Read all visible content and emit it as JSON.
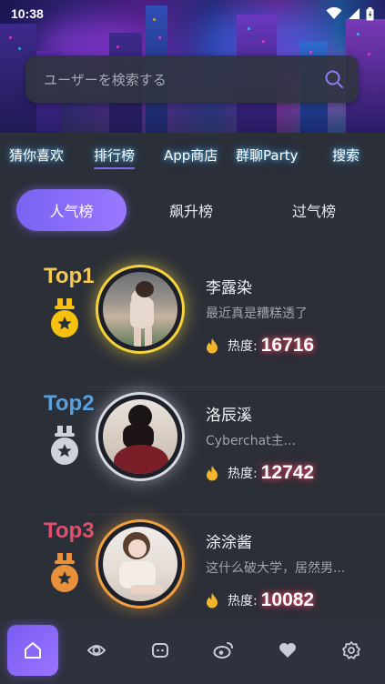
{
  "status_bar": {
    "time": "10:38"
  },
  "search": {
    "placeholder": "ユーザーを検索する"
  },
  "nav": {
    "items": [
      {
        "label": "猜你喜欢",
        "active": false
      },
      {
        "label": "排行榜",
        "active": true
      },
      {
        "label": "App商店",
        "active": false
      },
      {
        "label": "群聊Party",
        "active": false
      },
      {
        "label": "搜索",
        "active": false
      }
    ]
  },
  "tabs": {
    "items": [
      {
        "label": "人气榜",
        "active": true
      },
      {
        "label": "飙升榜",
        "active": false
      },
      {
        "label": "过气榜",
        "active": false
      }
    ]
  },
  "ranking": [
    {
      "rank_label": "Top1",
      "rank_color": "#f3c955",
      "medal_color": "#f6c20f",
      "ring_color": "#f3d23a",
      "name": "李露染",
      "bio": "最近真是糟糕透了",
      "heat_label": "热度:",
      "heat_value": "16716"
    },
    {
      "rank_label": "Top2",
      "rank_color": "#5aa0de",
      "medal_color": "#cfd2d8",
      "ring_color": "#d6d9e0",
      "name": "洛辰溪",
      "bio": "Cyberchat主...",
      "heat_label": "热度:",
      "heat_value": "12742"
    },
    {
      "rank_label": "Top3",
      "rank_color": "#e0506e",
      "medal_color": "#e8913a",
      "ring_color": "#f0a040",
      "name": "涂涂酱",
      "bio": "这什么破大学，居然男...",
      "heat_label": "热度:",
      "heat_value": "10082"
    }
  ],
  "bottom_nav": [
    {
      "icon": "home-icon",
      "active": true
    },
    {
      "icon": "eye-icon",
      "active": false
    },
    {
      "icon": "chat-icon",
      "active": false
    },
    {
      "icon": "weibo-icon",
      "active": false
    },
    {
      "icon": "heart-icon",
      "active": false
    },
    {
      "icon": "settings-icon",
      "active": false
    }
  ],
  "colors": {
    "accent": "#7c62f2",
    "background": "#2b2f38",
    "heat_glow": "#ff4c6e"
  }
}
